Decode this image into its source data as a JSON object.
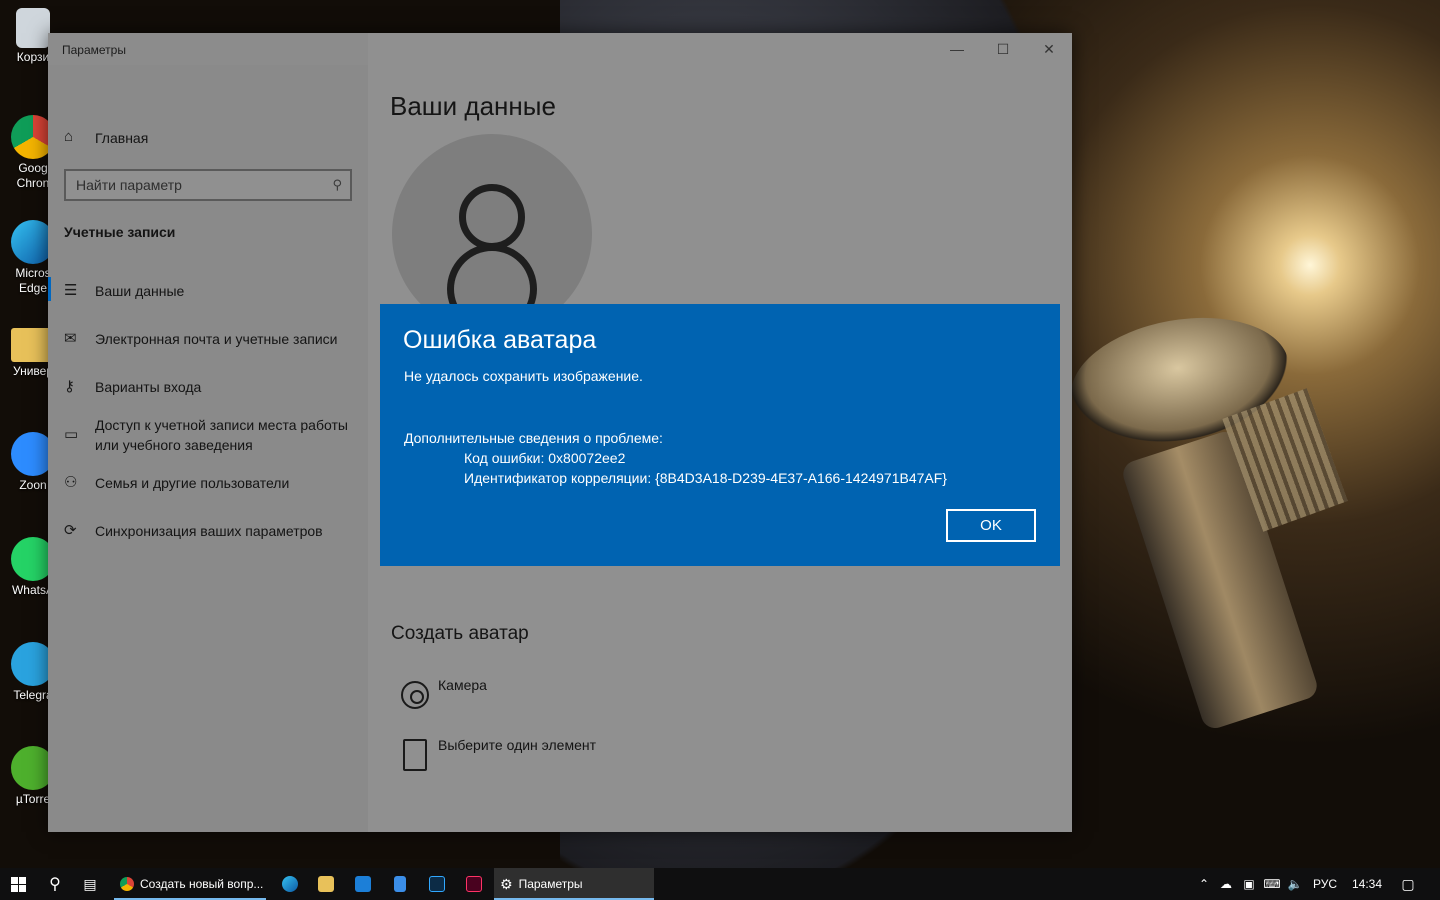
{
  "desktop": {
    "icons": [
      {
        "label": "Корзи",
        "icon": "recycle-bin-icon"
      },
      {
        "label": "Goog Chron",
        "icon": "chrome-icon"
      },
      {
        "label": "Micros Edge",
        "icon": "edge-icon"
      },
      {
        "label": "Универ",
        "icon": "folder-icon"
      },
      {
        "label": "Zoon",
        "icon": "zoom-icon"
      },
      {
        "label": "WhatsA",
        "icon": "whatsapp-icon"
      },
      {
        "label": "Telegra",
        "icon": "telegram-icon"
      },
      {
        "label": "µTorre",
        "icon": "utorrent-icon"
      }
    ]
  },
  "window": {
    "title": "Параметры",
    "controls": {
      "minimize": "—",
      "maximize": "☐",
      "close": "✕"
    }
  },
  "sidebar": {
    "home_label": "Главная",
    "search_placeholder": "Найти параметр",
    "section_title": "Учетные записи",
    "items": [
      {
        "label": "Ваши данные",
        "icon": "person-card-icon"
      },
      {
        "label": "Электронная почта и учетные записи",
        "icon": "mail-icon"
      },
      {
        "label": "Варианты входа",
        "icon": "key-icon"
      },
      {
        "label": "Доступ к учетной записи места работы или учебного заведения",
        "icon": "briefcase-icon"
      },
      {
        "label": "Семья и другие пользователи",
        "icon": "add-person-icon"
      },
      {
        "label": "Синхронизация ваших параметров",
        "icon": "sync-icon"
      }
    ]
  },
  "main": {
    "title": "Ваши данные",
    "create_avatar_title": "Создать аватар",
    "options": [
      {
        "label": "Камера",
        "icon": "camera-icon"
      },
      {
        "label": "Выберите один элемент",
        "icon": "file-icon"
      }
    ]
  },
  "dialog": {
    "title": "Ошибка аватара",
    "message": "Не удалось сохранить изображение.",
    "details_heading": "Дополнительные сведения о проблеме:",
    "error_code": "Код ошибки: 0x80072ee2",
    "correlation_id": "Идентификатор корреляции: {8B4D3A18-D239-4E37-A166-1424971B47AF}",
    "ok_label": "OK"
  },
  "taskbar": {
    "apps": [
      {
        "label": "Создать новый вопр...",
        "icon": "chrome-icon",
        "active": false
      },
      {
        "label": "Параметры",
        "icon": "gear-icon",
        "active": true
      }
    ],
    "language": "РУС",
    "time": "14:34"
  },
  "colors": {
    "dialog_bg": "#0063b1",
    "accent": "#0067c0",
    "taskbar_bg": "#0f0f10"
  }
}
